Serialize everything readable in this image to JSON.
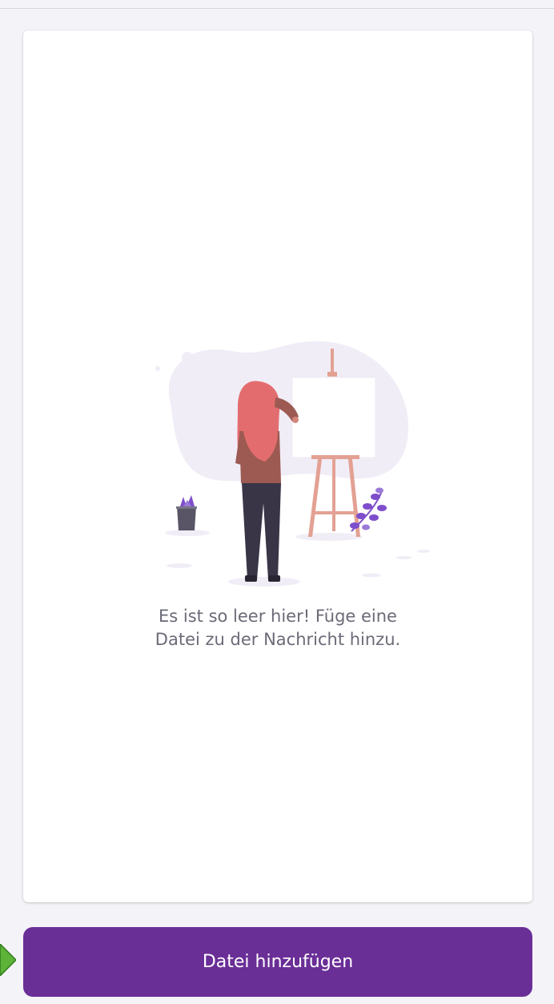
{
  "empty_state": {
    "message": "Es ist so leer hier! Füge eine\nDatei zu der Nachricht hinzu.",
    "illustration_icon": "woman-painting-easel-icon"
  },
  "actions": {
    "add_file_label": "Datei hinzufügen"
  },
  "colors": {
    "accent": "#6a2e97",
    "background": "#f4f3f7",
    "card": "#ffffff",
    "blob": "#f1edf7",
    "hair": "#e36d6e",
    "easel": "#e3a193",
    "plant": "#7e4ecb"
  }
}
